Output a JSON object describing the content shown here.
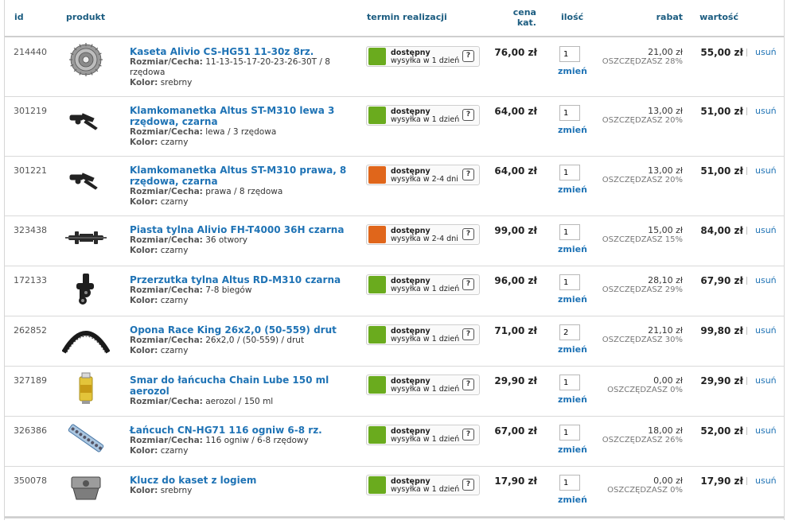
{
  "header": {
    "id": "id",
    "product": "produkt",
    "lead_time": "termin realizacji",
    "price_line1": "cena",
    "price_line2": "kat.",
    "qty": "ilość",
    "discount": "rabat",
    "value": "wartość"
  },
  "labels": {
    "size": "Rozmiar/Cecha:",
    "color": "Kolor:",
    "update": "zmień",
    "remove": "usuń",
    "available": "dostępny",
    "help": "?"
  },
  "colors": {
    "available_green": "#6aab1e",
    "available_orange": "#e0661b",
    "link_blue": "#1f73b5",
    "header_blue": "#1b5c80"
  },
  "rows": [
    {
      "id": "214440",
      "icon": "cassette-icon",
      "name": "Kaseta Alivio CS-HG51 11-30z 8rz.",
      "size": "11-13-15-17-20-23-26-30T / 8 rzędowa",
      "color": "srebrny",
      "status": "green",
      "shipping": "wysyłka w 1 dzień",
      "price": "76,00 zł",
      "qty": "1",
      "discount": "21,00 zł",
      "save": "OSZCZĘDZASZ 28%",
      "value": "55,00 zł"
    },
    {
      "id": "301219",
      "icon": "shifter-icon",
      "name": "Klamkomanetka Altus ST-M310 lewa 3 rzędowa, czarna",
      "size": "lewa / 3 rzędowa",
      "color": "czarny",
      "status": "green",
      "shipping": "wysyłka w 1 dzień",
      "price": "64,00 zł",
      "qty": "1",
      "discount": "13,00 zł",
      "save": "OSZCZĘDZASZ 20%",
      "value": "51,00 zł"
    },
    {
      "id": "301221",
      "icon": "shifter-icon",
      "name": "Klamkomanetka Altus ST-M310 prawa, 8 rzędowa, czarna",
      "size": "prawa / 8 rzędowa",
      "color": "czarny",
      "status": "orange",
      "shipping": "wysyłka w 2-4 dni",
      "price": "64,00 zł",
      "qty": "1",
      "discount": "13,00 zł",
      "save": "OSZCZĘDZASZ 20%",
      "value": "51,00 zł"
    },
    {
      "id": "323438",
      "icon": "hub-icon",
      "name": "Piasta tylna Alivio FH-T4000 36H czarna",
      "size": "36 otwory",
      "color": "czarny",
      "status": "orange",
      "shipping": "wysyłka w 2-4 dni",
      "price": "99,00 zł",
      "qty": "1",
      "discount": "15,00 zł",
      "save": "OSZCZĘDZASZ 15%",
      "value": "84,00 zł"
    },
    {
      "id": "172133",
      "icon": "derailleur-icon",
      "name": "Przerzutka tylna Altus RD-M310 czarna",
      "size": "7-8 biegów",
      "color": "czarny",
      "status": "green",
      "shipping": "wysyłka w 1 dzień",
      "price": "96,00 zł",
      "qty": "1",
      "discount": "28,10 zł",
      "save": "OSZCZĘDZASZ 29%",
      "value": "67,90 zł"
    },
    {
      "id": "262852",
      "icon": "tire-icon",
      "name": "Opona Race King 26x2,0 (50-559) drut",
      "size": "26x2,0 / (50-559) / drut",
      "color": "czarny",
      "status": "green",
      "shipping": "wysyłka w 1 dzień",
      "price": "71,00 zł",
      "qty": "2",
      "discount": "21,10 zł",
      "save": "OSZCZĘDZASZ 30%",
      "value": "99,80 zł"
    },
    {
      "id": "327189",
      "icon": "lube-can-icon",
      "name": "Smar do łańcucha Chain Lube 150 ml aerozol",
      "size": "aerozol / 150 ml",
      "color": "",
      "status": "green",
      "shipping": "wysyłka w 1 dzień",
      "price": "29,90 zł",
      "qty": "1",
      "discount": "0,00 zł",
      "save": "OSZCZĘDZASZ 0%",
      "value": "29,90 zł"
    },
    {
      "id": "326386",
      "icon": "chain-icon",
      "name": "Łańcuch CN-HG71 116 ogniw 6-8 rz.",
      "size": "116 ogniw / 6-8 rzędowy",
      "color": "czarny",
      "status": "green",
      "shipping": "wysyłka w 1 dzień",
      "price": "67,00 zł",
      "qty": "1",
      "discount": "18,00 zł",
      "save": "OSZCZĘDZASZ 26%",
      "value": "52,00 zł"
    },
    {
      "id": "350078",
      "icon": "cassette-tool-icon",
      "name": "Klucz do kaset z logiem",
      "size": "",
      "color": "srebrny",
      "status": "green",
      "shipping": "wysyłka w 1 dzień",
      "price": "17,90 zł",
      "qty": "1",
      "discount": "0,00 zł",
      "save": "OSZCZĘDZASZ 0%",
      "value": "17,90 zł"
    }
  ]
}
